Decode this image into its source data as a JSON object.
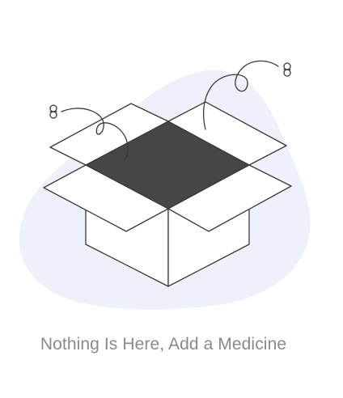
{
  "empty_state": {
    "message": "Nothing Is Here, Add a Medicine",
    "illustration_icon": "empty-open-box-icon"
  },
  "colors": {
    "background": "#ffffff",
    "blob": "#eef0fb",
    "line": "#3a3a3a",
    "box_interior": "#464646",
    "message_text": "#8a8a8a"
  }
}
